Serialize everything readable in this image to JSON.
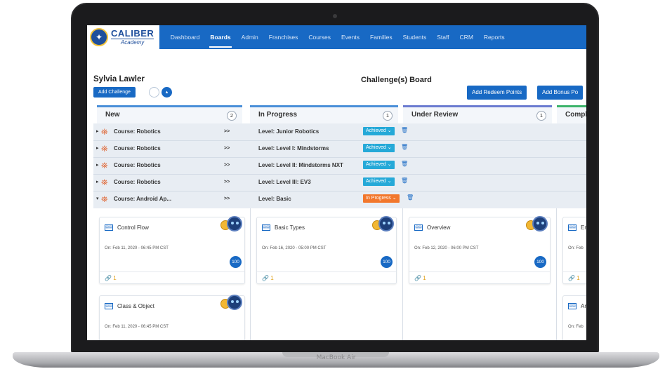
{
  "device": {
    "label": "MacBook Air"
  },
  "nav": {
    "logo": {
      "name": "CALIBER",
      "subtitle": "Academy"
    },
    "items": [
      {
        "label": "Dashboard",
        "active": false
      },
      {
        "label": "Boards",
        "active": true
      },
      {
        "label": "Admin",
        "active": false
      },
      {
        "label": "Franchises",
        "active": false
      },
      {
        "label": "Courses",
        "active": false
      },
      {
        "label": "Events",
        "active": false
      },
      {
        "label": "Families",
        "active": false
      },
      {
        "label": "Students",
        "active": false
      },
      {
        "label": "Staff",
        "active": false
      },
      {
        "label": "CRM",
        "active": false
      },
      {
        "label": "Reports",
        "active": false
      }
    ]
  },
  "header": {
    "student_name": "Sylvia Lawler",
    "add_challenge": "Add Challenge",
    "board_title": "Challenge(s) Board",
    "redeem_button": "Add Redeem Points",
    "bonus_button": "Add Bonus Po"
  },
  "columns": [
    {
      "title": "New",
      "count": "2"
    },
    {
      "title": "In Progress",
      "count": "1"
    },
    {
      "title": "Under Review",
      "count": "1"
    },
    {
      "title": "Compl",
      "count": ""
    }
  ],
  "colors": {
    "nav": "#1869c4",
    "achieved": "#25a9d8",
    "in_progress": "#f2772c",
    "new": "#4a8fd8",
    "review": "#6b7bd0",
    "complete": "#3bb36a"
  },
  "rows": [
    {
      "arrow": "▸",
      "course": "Course: Robotics",
      "go": ">>",
      "level": "Level: Junior Robotics",
      "status": "Achieved ⌄",
      "status_type": "achieved"
    },
    {
      "arrow": "▸",
      "course": "Course: Robotics",
      "go": ">>",
      "level": "Level: Level I: Mindstorms",
      "status": "Achieved ⌄",
      "status_type": "achieved"
    },
    {
      "arrow": "▸",
      "course": "Course: Robotics",
      "go": ">>",
      "level": "Level: Level II: Mindstorms NXT",
      "status": "Achieved ⌄",
      "status_type": "achieved"
    },
    {
      "arrow": "▸",
      "course": "Course: Robotics",
      "go": ">>",
      "level": "Level: Level III: EV3",
      "status": "Achieved ⌄",
      "status_type": "achieved"
    },
    {
      "arrow": "▾",
      "course": "Course: Android Ap...",
      "go": ">>",
      "level": "Level: Basic",
      "status": "In Progress ⌄",
      "status_type": "progress"
    }
  ],
  "lanes": [
    {
      "cards": [
        {
          "title": "Control Flow",
          "date": "On: Feb 11, 2020 - 06:45 PM CST",
          "points": "100",
          "attachments": "1"
        },
        {
          "title": "Class & Object",
          "date": "On: Feb 11, 2020 - 06:45 PM CST",
          "points": "",
          "attachments": ""
        }
      ]
    },
    {
      "cards": [
        {
          "title": "Basic Types",
          "date": "On: Feb 16, 2020 - 05:00 PM CST",
          "points": "100",
          "attachments": "1"
        }
      ]
    },
    {
      "cards": [
        {
          "title": "Overview",
          "date": "On: Feb 12, 2020 - 06:00 PM CST",
          "points": "100",
          "attachments": "1"
        }
      ]
    },
    {
      "cards": [
        {
          "title": "En",
          "date": "On: Feb",
          "points": "",
          "attachments": "1"
        },
        {
          "title": "Ar",
          "date": "On: Feb",
          "points": "",
          "attachments": ""
        }
      ]
    }
  ]
}
